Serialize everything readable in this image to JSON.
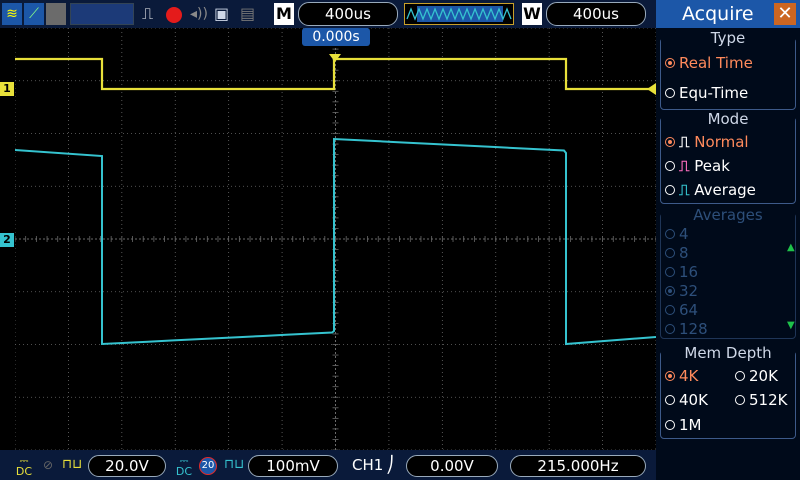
{
  "top_bar": {
    "timebase_label": "M",
    "timebase_value": "400us",
    "window_label": "W",
    "window_value": "400us",
    "trigger_time": "0.000s"
  },
  "bottom_bar": {
    "ch1_volts": "20.0V",
    "ch2_badge": "20",
    "ch2_volts": "100mV",
    "trigger_source": "CH1",
    "trigger_level": "0.00V",
    "frequency": "215.000Hz"
  },
  "channel_markers": {
    "ch1": "1",
    "ch2": "2"
  },
  "menu": {
    "title": "Acquire",
    "type_title": "Type",
    "type_options": [
      {
        "label": "Real Time",
        "selected": true
      },
      {
        "label": "Equ-Time",
        "selected": false
      }
    ],
    "mode_title": "Mode",
    "mode_options": [
      {
        "label": "Normal",
        "selected": true
      },
      {
        "label": "Peak",
        "selected": false
      },
      {
        "label": "Average",
        "selected": false
      }
    ],
    "averages_title": "Averages",
    "averages_options": [
      "4",
      "8",
      "16",
      "32",
      "64",
      "128"
    ],
    "averages_selected": "32",
    "memdepth_title": "Mem Depth",
    "memdepth_options": [
      {
        "label": "4K",
        "selected": true
      },
      {
        "label": "20K",
        "selected": false
      },
      {
        "label": "40K",
        "selected": false
      },
      {
        "label": "512K",
        "selected": false
      },
      {
        "label": "1M",
        "selected": false
      }
    ]
  },
  "colors": {
    "ch1": "#e8e03a",
    "ch2": "#35c3cf",
    "grid": "#6a6a6a",
    "menu_header": "#1c57a8",
    "selected": "#ff8a5c"
  }
}
